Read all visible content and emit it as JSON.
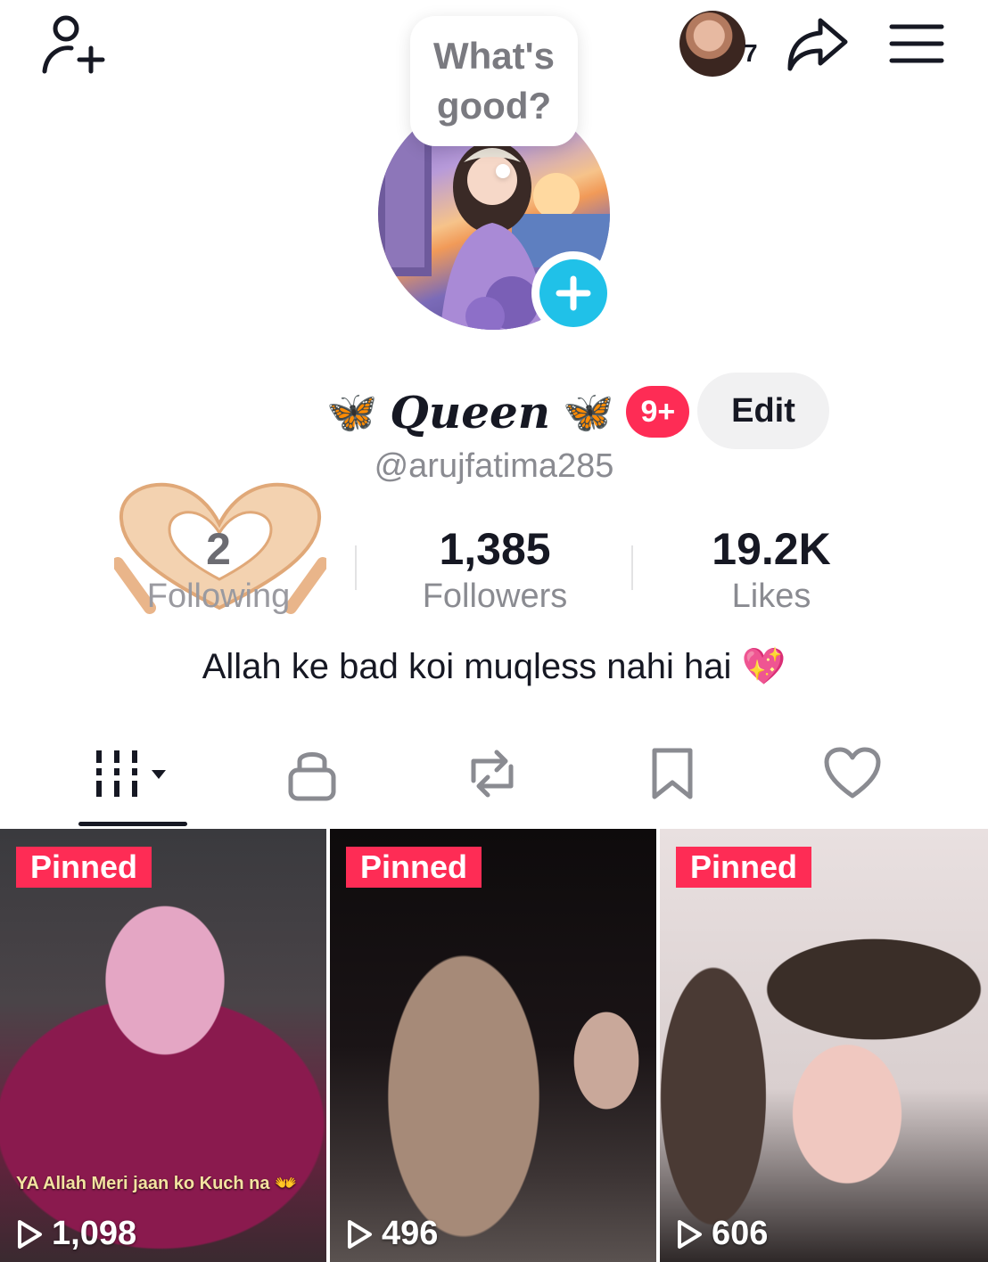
{
  "top_bar": {
    "add_friend_icon": "person-plus-icon",
    "story_viewer_count": "7",
    "share_icon": "share-arrow-icon",
    "menu_icon": "hamburger-menu-icon"
  },
  "status_bubble": {
    "text": "What's good?"
  },
  "profile": {
    "name": "Queen",
    "name_decoration": "🦋",
    "notification_badge": "9+",
    "edit_label": "Edit",
    "handle": "@arujfatima285",
    "bio": "Allah ke bad koi muqless nahi hai 💖"
  },
  "stats": {
    "following": {
      "value": "2",
      "label": "Following"
    },
    "followers": {
      "value": "1,385",
      "label": "Followers"
    },
    "likes": {
      "value": "19.2K",
      "label": "Likes"
    }
  },
  "tabs": [
    {
      "icon": "grid-videos-icon",
      "active": true
    },
    {
      "icon": "lock-icon",
      "active": false
    },
    {
      "icon": "repost-icon",
      "active": false
    },
    {
      "icon": "bookmark-icon",
      "active": false
    },
    {
      "icon": "heart-icon",
      "active": false
    }
  ],
  "videos": [
    {
      "pinned_label": "Pinned",
      "views": "1,098",
      "caption": "YA Allah Meri jaan ko Kuch na 👐"
    },
    {
      "pinned_label": "Pinned",
      "views": "496"
    },
    {
      "pinned_label": "Pinned",
      "views": "606"
    }
  ],
  "colors": {
    "accent_red": "#fe2c55",
    "accent_cyan": "#20c1e8",
    "text_primary": "#161823",
    "text_secondary": "#8a8b91"
  }
}
